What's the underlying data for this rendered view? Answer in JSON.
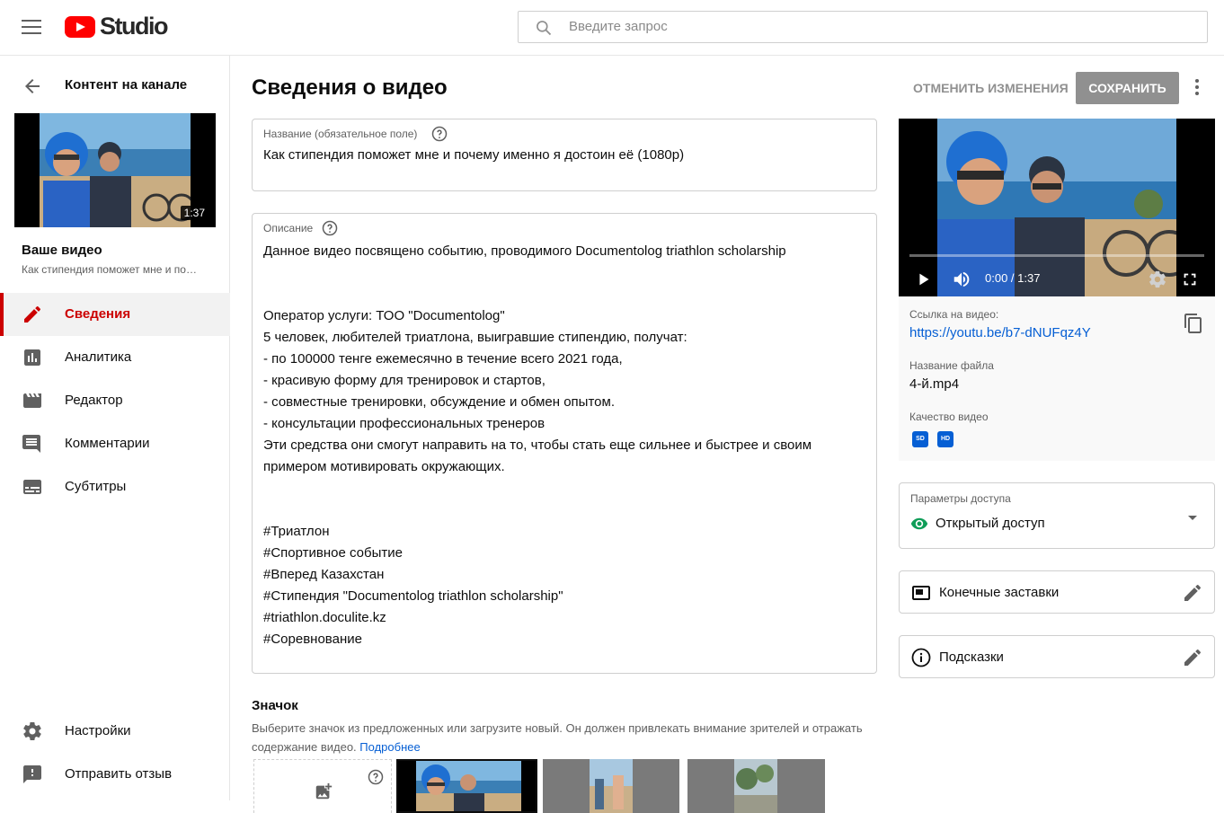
{
  "header": {
    "logo_text": "Studio",
    "search_placeholder": "Введите запрос"
  },
  "sidebar": {
    "channel_title": "Контент на канале",
    "thumb_duration": "1:37",
    "your_video_label": "Ваше видео",
    "your_video_subtitle": "Как стипендия поможет мне и по…",
    "nav": [
      {
        "label": "Сведения",
        "icon": "pencil-icon",
        "active": true
      },
      {
        "label": "Аналитика",
        "icon": "analytics-icon"
      },
      {
        "label": "Редактор",
        "icon": "clapperboard-icon"
      },
      {
        "label": "Комментарии",
        "icon": "comment-icon"
      },
      {
        "label": "Субтитры",
        "icon": "subtitles-icon"
      }
    ],
    "bottom_nav": [
      {
        "label": "Настройки",
        "icon": "gear-icon"
      },
      {
        "label": "Отправить отзыв",
        "icon": "feedback-icon"
      }
    ]
  },
  "main": {
    "page_title": "Сведения о видео",
    "undo_label": "ОТМЕНИТЬ ИЗМЕНЕНИЯ",
    "save_label": "СОХРАНИТЬ",
    "title_field": {
      "label": "Название (обязательное поле)",
      "value": "Как стипендия поможет мне и почему именно я достоин её (1080р)"
    },
    "description_field": {
      "label": "Описание",
      "lines": [
        "Данное видео посвящено событию, проводимого Documentolog triathlon scholarship",
        "",
        "",
        "Оператор услуги: ТОО \"Documentolog\"",
        "5 человек, любителей триатлона, выигравшие стипендию, получат:",
        "- по 100000 тенге ежемесячно в течение всего 2021 года,",
        "- красивую форму для тренировок и стартов,",
        "- совместные тренировки, обсуждение и обмен опытом.",
        "- консультации профессиональных тренеров",
        "Эти средства они смогут направить на то, чтобы стать еще сильнее и быстрее и своим",
        "примером мотивировать окружающих.",
        "",
        "",
        "#Триатлон",
        "#Спортивное событие",
        "#Вперед Казахстан",
        "#Стипендия \"Documentolog triathlon scholarship\"",
        "#triathlon.doculite.kz",
        "#Соревнование"
      ]
    },
    "thumbnail": {
      "heading": "Значок",
      "description": "Выберите значок из предложенных или загрузите новый. Он должен привлекать внимание зрителей и отражать содержание видео.",
      "learn_more": "Подробнее"
    }
  },
  "preview": {
    "time": "0:00 / 1:37",
    "link_label": "Ссылка на видео:",
    "link": "https://youtu.be/b7-dNUFqz4Y",
    "filename_label": "Название файла",
    "filename": "4-й.mp4",
    "quality_label": "Качество видео",
    "quality_badges": [
      "SD",
      "HD"
    ]
  },
  "visibility": {
    "label": "Параметры доступа",
    "value": "Открытый доступ"
  },
  "end_screens": {
    "label": "Конечные заставки"
  },
  "cards": {
    "label": "Подсказки"
  },
  "colors": {
    "accent_red": "#cc0000",
    "link_blue": "#065fd4",
    "visibility_green": "#0f9d58",
    "save_disabled": "#909090"
  }
}
